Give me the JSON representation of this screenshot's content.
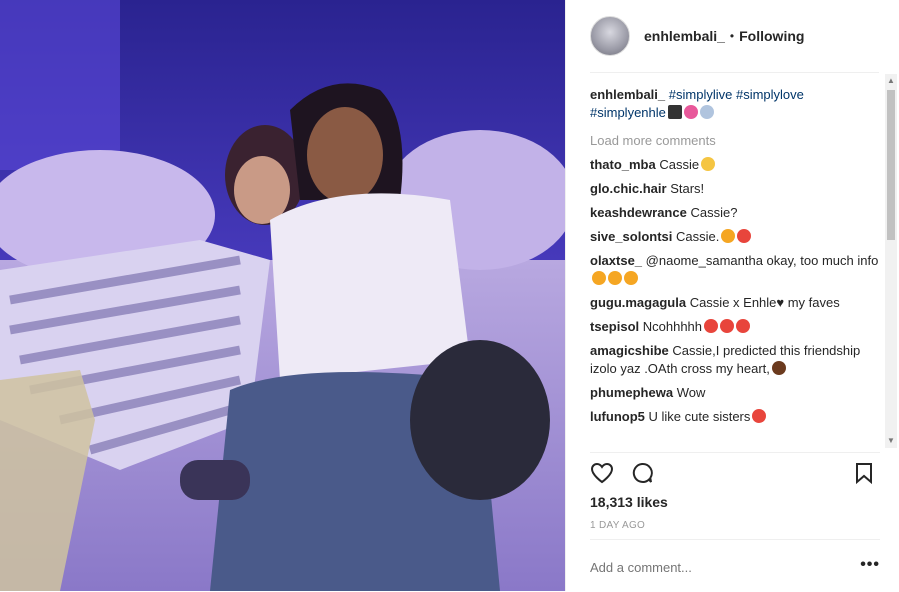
{
  "post": {
    "username": "enhlembali_",
    "dot": "•",
    "following": "Following",
    "caption": {
      "user": "enhlembali_",
      "tags": [
        "#simplylive",
        "#simplylove",
        "#simplyenhle"
      ]
    },
    "load_more": "Load more comments",
    "comments": [
      {
        "user": "thato_mba",
        "text": "Cassie",
        "emoji": [
          "#f5c542"
        ]
      },
      {
        "user": "glo.chic.hair",
        "text": "Stars!",
        "emoji": []
      },
      {
        "user": "keashdewrance",
        "text": "Cassie?",
        "emoji": []
      },
      {
        "user": "sive_solontsi",
        "text": "Cassie.",
        "emoji": [
          "#f5a623",
          "#e8453c"
        ]
      },
      {
        "user": "olaxtse_",
        "text": "@naome_samantha okay, too much info",
        "emoji": [
          "#f5a623",
          "#f5a623",
          "#f5a623"
        ]
      },
      {
        "user": "gugu.magagula",
        "text": "Cassie x Enhle♥ my faves",
        "emoji": []
      },
      {
        "user": "tsepisol",
        "text": "Ncohhhhh",
        "emoji": [
          "#e8453c",
          "#e8453c",
          "#e8453c"
        ]
      },
      {
        "user": "amagicshibe",
        "text": "Cassie,I predicted this friendship izolo yaz .OAth cross my heart,",
        "emoji": [
          "#6b3a1e"
        ]
      },
      {
        "user": "phumephewa",
        "text": "Wow",
        "emoji": []
      },
      {
        "user": "lufunop5",
        "text": "U like cute sisters",
        "emoji": [
          "#e8453c"
        ]
      }
    ],
    "likes": "18,313 likes",
    "time_ago": "1 DAY AGO",
    "add_comment_placeholder": "Add a comment...",
    "more": "•••"
  },
  "icons": {
    "heart": "heart-icon",
    "comment": "comment-icon",
    "bookmark": "bookmark-icon",
    "more": "more-options-icon"
  },
  "colors": {
    "link": "#003569",
    "muted": "#999999",
    "text": "#262626"
  }
}
